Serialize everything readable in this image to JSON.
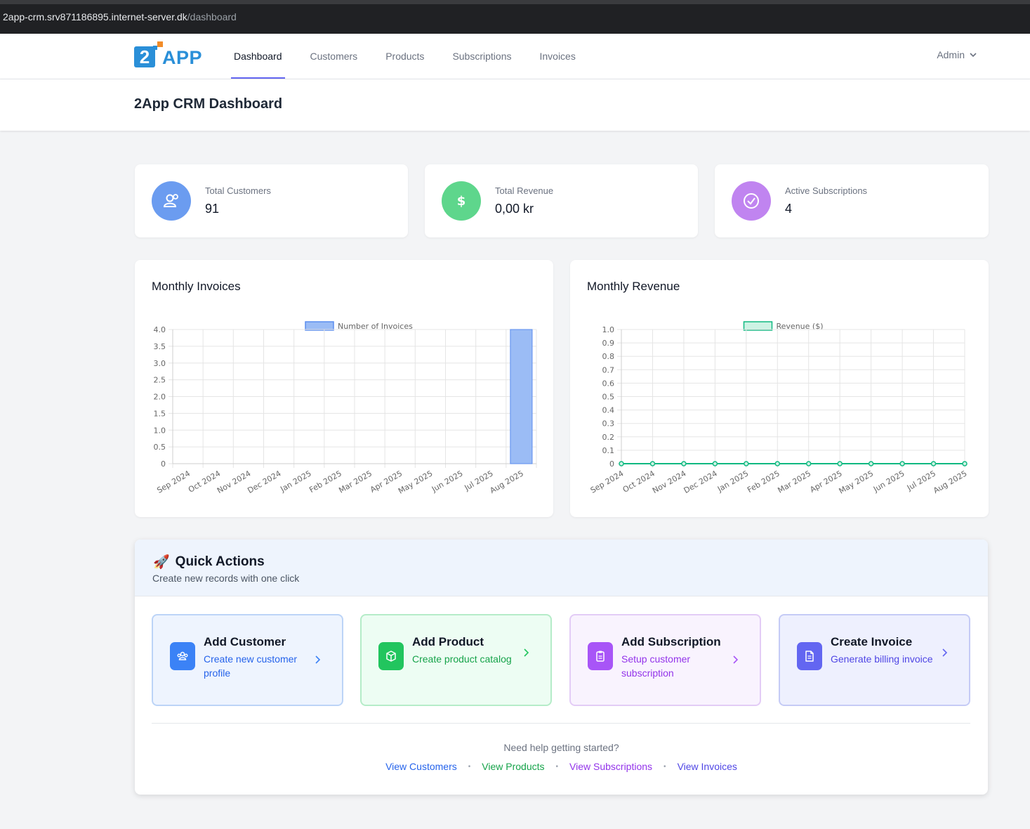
{
  "browser": {
    "url_host": "2app-crm.srv871186895.internet-server.dk",
    "url_path": "/dashboard"
  },
  "brand": {
    "logo_mark": "2",
    "logo_word": "APP"
  },
  "nav": {
    "items": [
      {
        "label": "Dashboard",
        "active": true
      },
      {
        "label": "Customers",
        "active": false
      },
      {
        "label": "Products",
        "active": false
      },
      {
        "label": "Subscriptions",
        "active": false
      },
      {
        "label": "Invoices",
        "active": false
      }
    ],
    "user_menu": "Admin"
  },
  "page": {
    "title": "2App CRM Dashboard"
  },
  "stats": [
    {
      "label": "Total Customers",
      "value": "91",
      "icon": "users-icon",
      "color": "#6b9cf0"
    },
    {
      "label": "Total Revenue",
      "value": "0,00 kr",
      "icon": "dollar-icon",
      "color": "#5ed68c"
    },
    {
      "label": "Active Subscriptions",
      "value": "4",
      "icon": "check-circle-icon",
      "color": "#c084f0"
    }
  ],
  "charts": {
    "invoices_title": "Monthly Invoices",
    "revenue_title": "Monthly Revenue"
  },
  "chart_data": [
    {
      "type": "bar",
      "title": "Monthly Invoices",
      "categories": [
        "Sep 2024",
        "Oct 2024",
        "Nov 2024",
        "Dec 2024",
        "Jan 2025",
        "Feb 2025",
        "Mar 2025",
        "Apr 2025",
        "May 2025",
        "Jun 2025",
        "Jul 2025",
        "Aug 2025"
      ],
      "series": [
        {
          "name": "Number of Invoices",
          "values": [
            0,
            0,
            0,
            0,
            0,
            0,
            0,
            0,
            0,
            0,
            0,
            4
          ],
          "color": "#9bbcf5",
          "border": "#5b8def"
        }
      ],
      "ylim": [
        0,
        4
      ],
      "yticks": [
        "0",
        "0.5",
        "1.0",
        "1.5",
        "2.0",
        "2.5",
        "3.0",
        "3.5",
        "4.0"
      ],
      "legend": "top-center",
      "grid": true
    },
    {
      "type": "line",
      "title": "Monthly Revenue",
      "categories": [
        "Sep 2024",
        "Oct 2024",
        "Nov 2024",
        "Dec 2024",
        "Jan 2025",
        "Feb 2025",
        "Mar 2025",
        "Apr 2025",
        "May 2025",
        "Jun 2025",
        "Jul 2025",
        "Aug 2025"
      ],
      "series": [
        {
          "name": "Revenue ($)",
          "values": [
            0,
            0,
            0,
            0,
            0,
            0,
            0,
            0,
            0,
            0,
            0,
            0
          ],
          "color": "#10b981",
          "fill": "#cdf3e4"
        }
      ],
      "ylim": [
        0,
        1
      ],
      "yticks": [
        "0",
        "0.1",
        "0.2",
        "0.3",
        "0.4",
        "0.5",
        "0.6",
        "0.7",
        "0.8",
        "0.9",
        "1.0"
      ],
      "legend": "top-center",
      "grid": true
    }
  ],
  "quick_actions": {
    "emoji": "🚀",
    "title": "Quick Actions",
    "subtitle": "Create new records with one click",
    "items": [
      {
        "title": "Add Customer",
        "desc": "Create new customer profile",
        "icon": "users-icon",
        "bg": "#eef4fe",
        "border": "#bcd4f7",
        "icbg": "#3b82f6",
        "desc_color": "#2563eb"
      },
      {
        "title": "Add Product",
        "desc": "Create product catalog",
        "icon": "box-icon",
        "bg": "#edfdf3",
        "border": "#b5ecc8",
        "icbg": "#22c55e",
        "desc_color": "#16a34a"
      },
      {
        "title": "Add Subscription",
        "desc": "Setup customer subscription",
        "icon": "clipboard-icon",
        "bg": "#f9f3fe",
        "border": "#e3ccf6",
        "icbg": "#a855f7",
        "desc_color": "#9333ea"
      },
      {
        "title": "Create Invoice",
        "desc": "Generate billing invoice",
        "icon": "document-icon",
        "bg": "#eef0fe",
        "border": "#c5cbf6",
        "icbg": "#6366f1",
        "desc_color": "#4f46e5"
      }
    ],
    "help_text": "Need help getting started?",
    "links": [
      {
        "label": "View Customers",
        "color": "#2563eb"
      },
      {
        "label": "View Products",
        "color": "#16a34a"
      },
      {
        "label": "View Subscriptions",
        "color": "#9333ea"
      },
      {
        "label": "View Invoices",
        "color": "#4f46e5"
      }
    ],
    "link_separator": "•"
  }
}
